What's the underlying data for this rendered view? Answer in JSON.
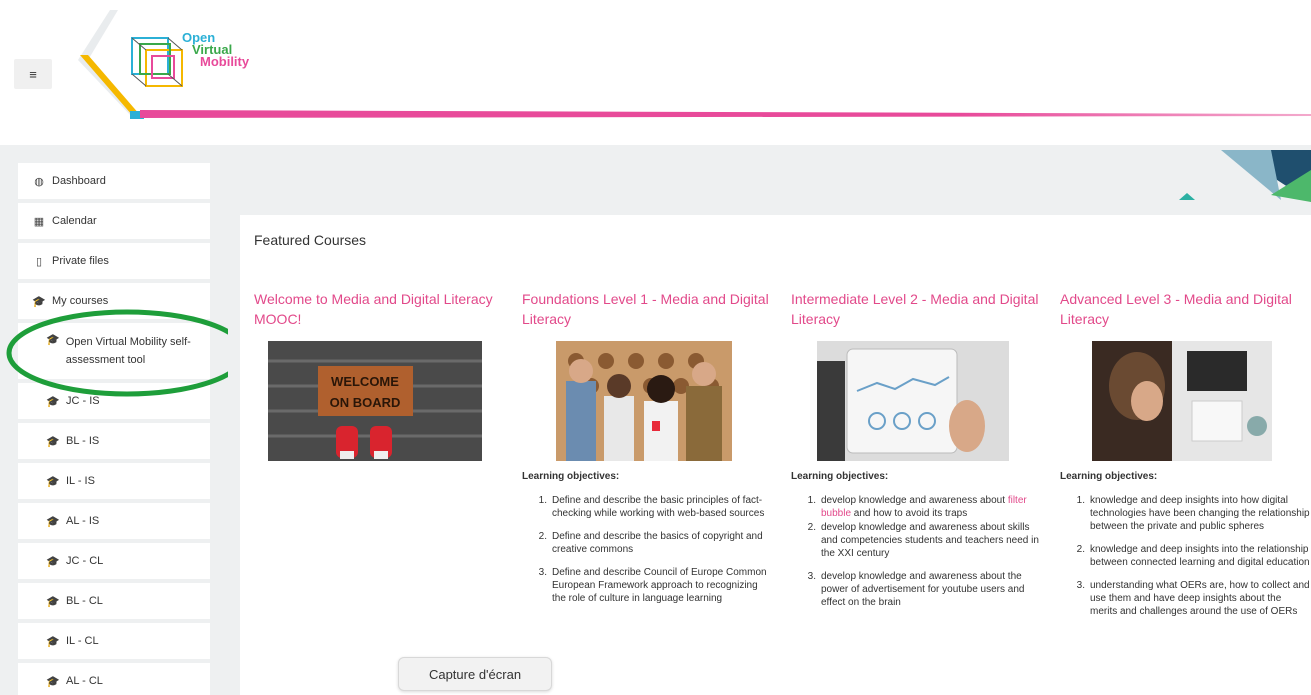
{
  "header": {
    "menu_icon": "≡",
    "logo": {
      "line1": "Open",
      "line2": "Virtual",
      "line3": "Mobility"
    }
  },
  "colors": {
    "pink": "#e2498a",
    "cyan": "#2bb0d6",
    "green": "#3aa84a",
    "yellow": "#f5b800",
    "highlight": "#1e9e3a"
  },
  "sidebar": {
    "items": [
      {
        "icon": "dashboard-icon",
        "glyph": "◍",
        "label": "Dashboard"
      },
      {
        "icon": "calendar-icon",
        "glyph": "▦",
        "label": "Calendar"
      },
      {
        "icon": "file-icon",
        "glyph": "▯",
        "label": "Private files"
      },
      {
        "icon": "graduation-cap-icon",
        "glyph": "🎓",
        "label": "My courses"
      },
      {
        "icon": "graduation-cap-icon",
        "glyph": "🎓",
        "label": "Open Virtual Mobility self-assessment tool"
      },
      {
        "icon": "graduation-cap-icon",
        "glyph": "🎓",
        "label": "JC - IS"
      },
      {
        "icon": "graduation-cap-icon",
        "glyph": "🎓",
        "label": "BL - IS"
      },
      {
        "icon": "graduation-cap-icon",
        "glyph": "🎓",
        "label": "IL - IS"
      },
      {
        "icon": "graduation-cap-icon",
        "glyph": "🎓",
        "label": "AL - IS"
      },
      {
        "icon": "graduation-cap-icon",
        "glyph": "🎓",
        "label": "JC - CL"
      },
      {
        "icon": "graduation-cap-icon",
        "glyph": "🎓",
        "label": "BL - CL"
      },
      {
        "icon": "graduation-cap-icon",
        "glyph": "🎓",
        "label": "IL - CL"
      },
      {
        "icon": "graduation-cap-icon",
        "glyph": "🎓",
        "label": "AL - CL"
      }
    ]
  },
  "main": {
    "section_title": "Featured Courses",
    "courses": [
      {
        "title": "Welcome to Media and Digital Literacy MOOC!",
        "image": "welcome-on-board-doormat",
        "image_text": [
          "WELCOME",
          "ON BOARD"
        ]
      },
      {
        "title": "Foundations Level 1 - Media and Digital Literacy",
        "image": "group-of-people-with-phones",
        "objectives_label": "Learning objectives:",
        "objectives": [
          "Define and describe the basic principles of fact-checking while working with web-based sources",
          "Define and describe the basics of copyright and creative commons",
          "Define and describe  Council of Europe Common European Framework approach to recognizing the role of culture in language learning"
        ]
      },
      {
        "title": "Intermediate Level 2 - Media and Digital Literacy",
        "image": "tablet-with-charts",
        "objectives_label": "Learning objectives:",
        "objectives_1_pre": "develop knowledge and awareness about ",
        "objectives_1_link": "filter bubble",
        "objectives_1_post": " and how to avoid its traps",
        "objectives": [
          "develop knowledge and awareness about skills and competencies students and teachers need in the XXI century",
          "develop knowledge and awareness about the power of advertisement for youtube users and effect on the brain"
        ]
      },
      {
        "title": "Advanced Level 3 - Media and Digital Literacy",
        "image": "woman-working-at-desk",
        "objectives_label": "Learning objectives:",
        "objectives": [
          "knowledge and deep insights into how digital technologies have been changing the relationship between the private and public spheres",
          "knowledge and deep insights into the relationship between connected learning and digital education",
          "understanding what OERs are, how to collect and use them and have deep insights about the merits and challenges around the use of OERs"
        ]
      }
    ]
  },
  "tooltip": {
    "text": "Capture d'écran"
  }
}
